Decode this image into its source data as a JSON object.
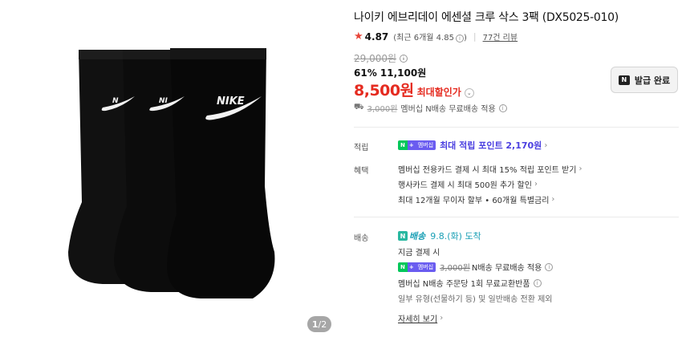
{
  "product": {
    "title": "나이키 에브리데이 에센셜 크루 삭스 3팩 (DX5025-010)",
    "image_alt": "black nike crew socks 3 pack",
    "pager": {
      "current": "1",
      "separator": "/",
      "total": "2"
    }
  },
  "rating": {
    "score": "4.87",
    "recent": "(최근 6개월 4.85",
    "recent_close": ")",
    "reviews": "77건 리뷰"
  },
  "price": {
    "original": "29,000원",
    "discount_rate": "61%",
    "discounted": "11,100원",
    "final": "8,500원",
    "final_label": "최대할인가",
    "chevron": "⌄"
  },
  "coupon": {
    "label": "발급 완료",
    "badge": "N"
  },
  "shipping_fee": {
    "original": "3,000원",
    "text": "멤버십 N배송 무료배송 적용"
  },
  "benefits": {
    "points_label": "적립",
    "points_badge_n": "N",
    "points_badge_plus": "+",
    "points_badge_mem": "멤버십",
    "points_text": "최대 적립 포인트 2,170원",
    "benefit_label": "혜택",
    "items": [
      "멤버십 전용카드 결제 시 최대 15% 적립 포인트 받기",
      "행사카드 결제 시 최대 500원 추가 할인",
      "최대 12개월 무이자 할부 • 60개월 특별금리"
    ]
  },
  "delivery": {
    "label": "배송",
    "badge_n": "N",
    "badge_text": "배송",
    "date": "9.8.(화) 도착",
    "condition": "지금 결제 시",
    "fee_original": "3,000원",
    "fee_text": "N배송 무료배송 적용",
    "return_text": "멤버십 N배송 주문당 1회 무료교환반품",
    "exception": "일부 유형(선물하기 등) 및 일반배송 전환 제외",
    "more": "자세히 보기"
  },
  "icons": {
    "info": "i",
    "gt": "›",
    "star": "★",
    "truck": "⛟"
  }
}
